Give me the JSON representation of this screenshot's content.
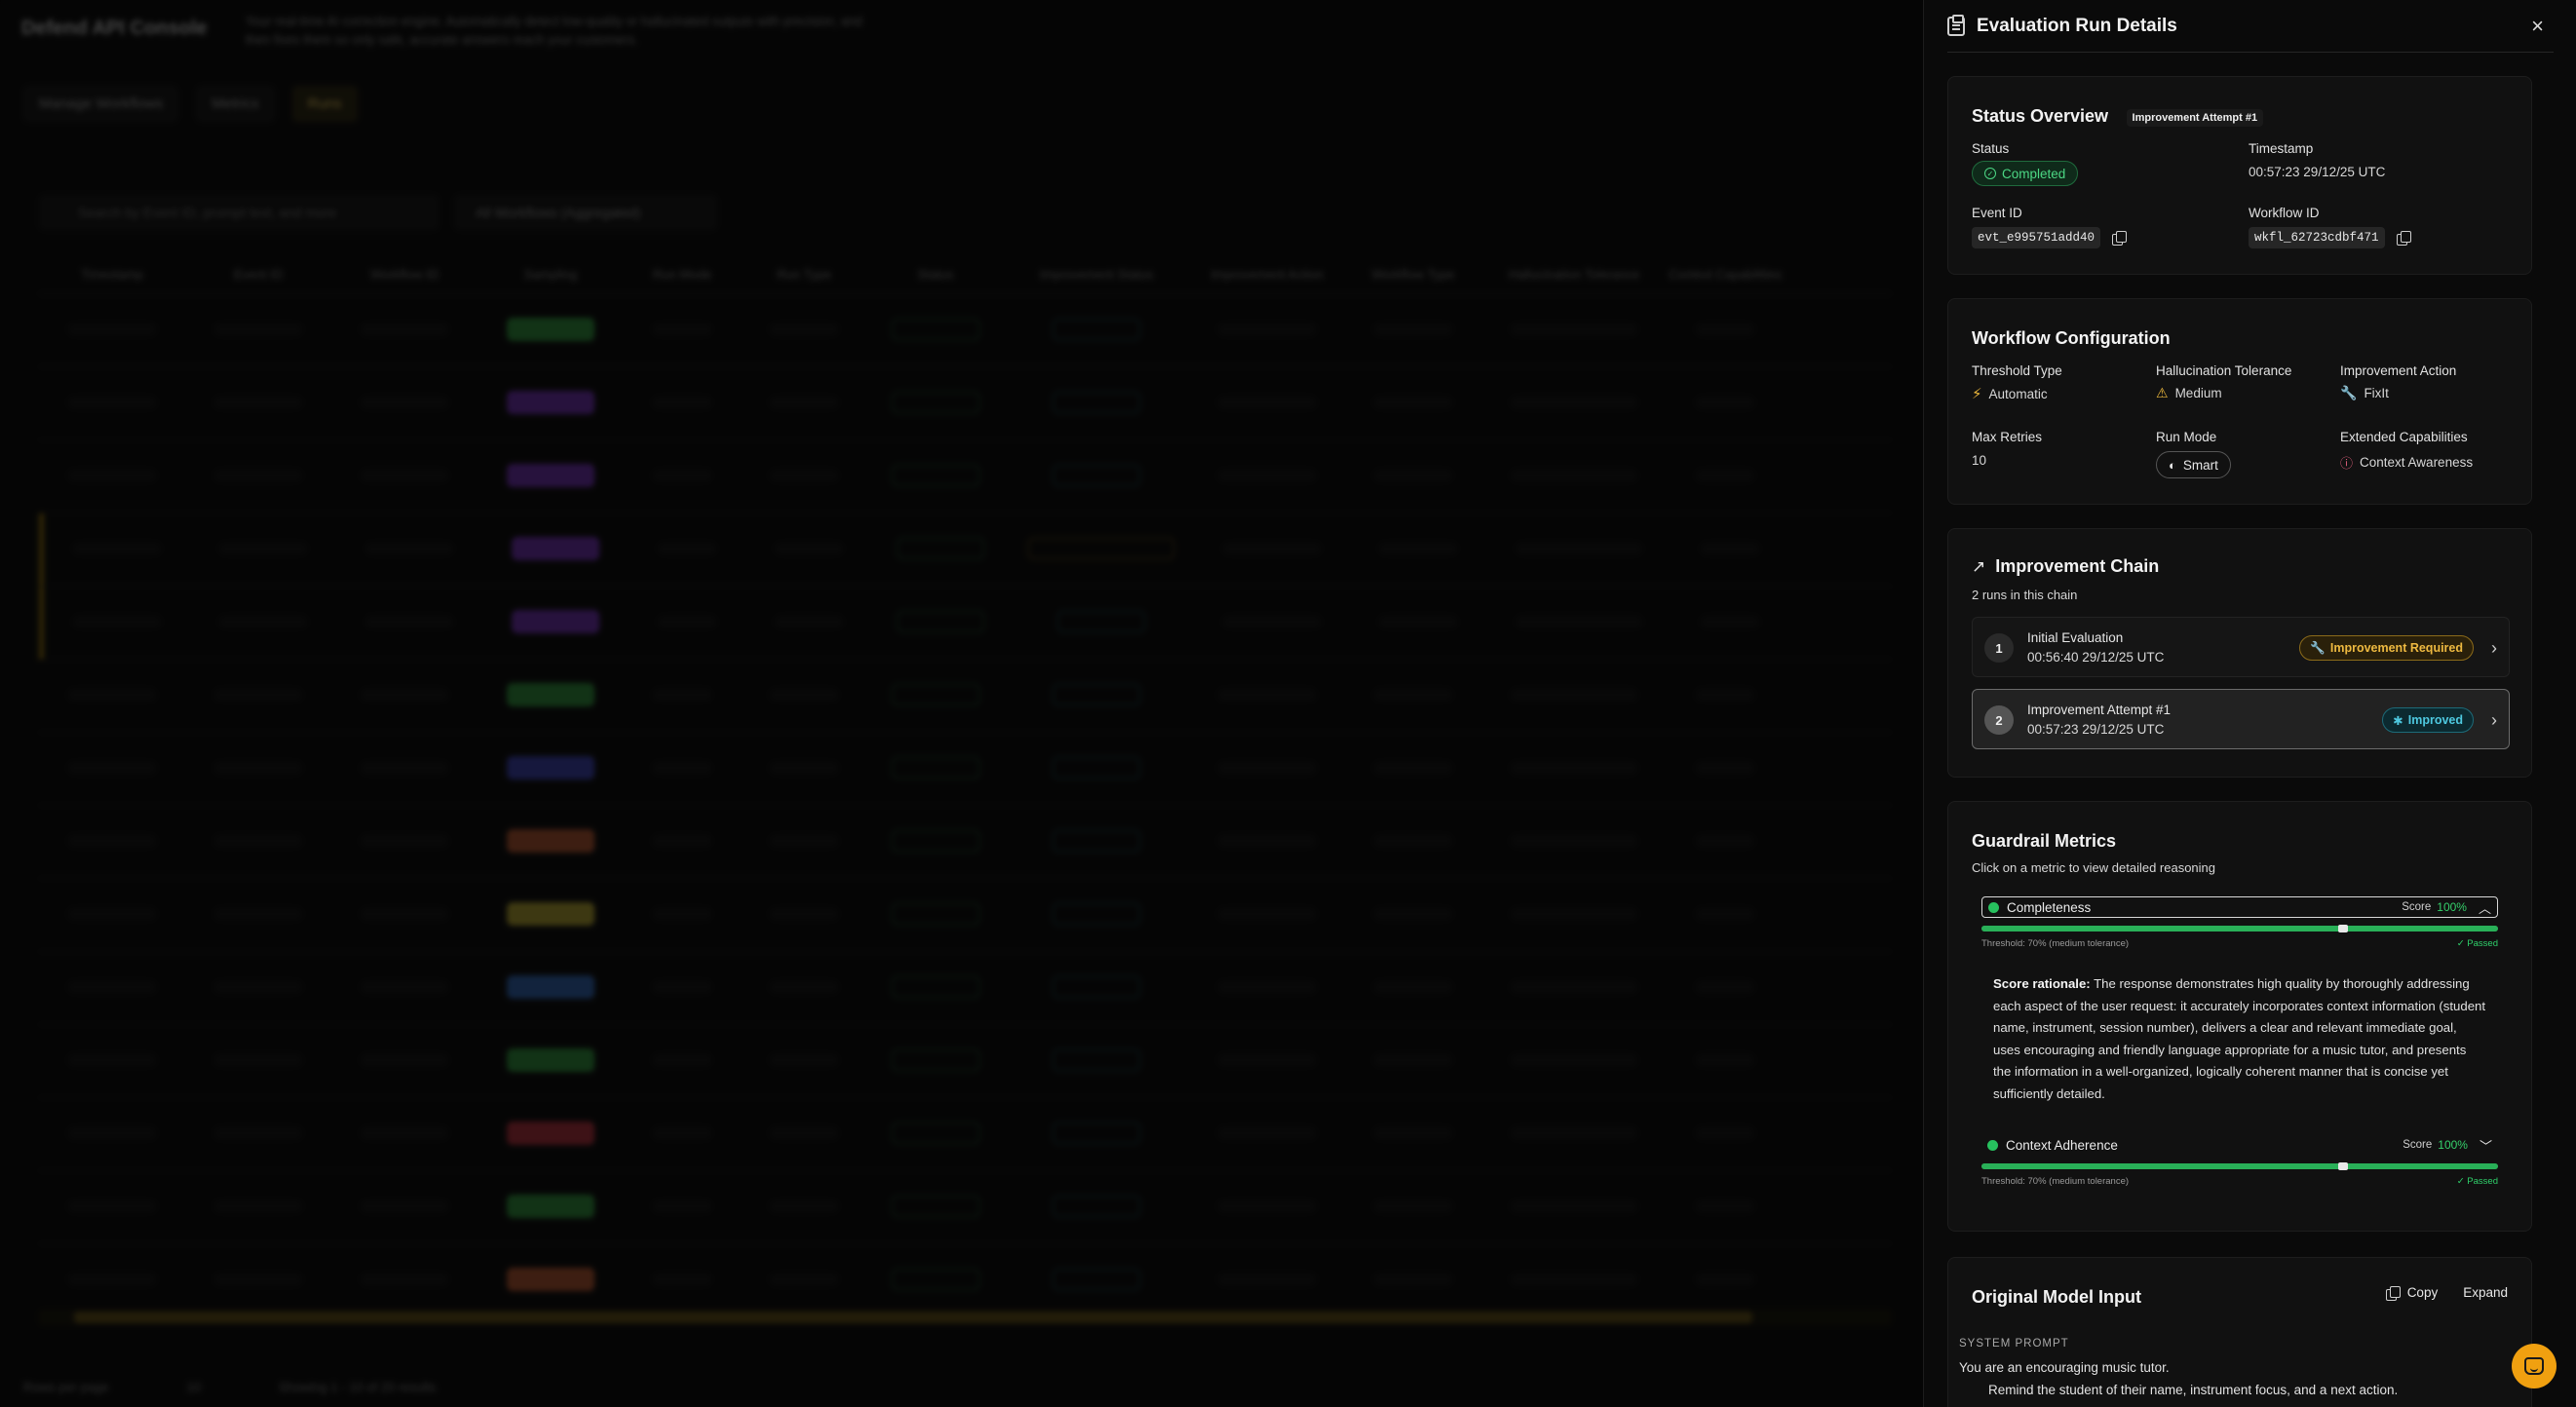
{
  "background": {
    "logo": "Defend API Console",
    "description": "Your real-time AI correction engine. Automatically detect low-quality or hallucinated outputs with precision, and then fixes them so only safe, accurate answers reach your customers.",
    "tabs": [
      "Manage Workflows",
      "Metrics",
      "Runs"
    ],
    "search_placeholder": "Search by Event ID, prompt text, and more",
    "workflow_filter": "All Workflows (Aggregated)",
    "columns": [
      "Timestamp",
      "Event ID",
      "Workflow ID",
      "Sampling",
      "Run Mode",
      "Run Type",
      "Status",
      "Improvement Status",
      "Improvement Action",
      "Workflow Type",
      "Hallucination Tolerance",
      "Context Capabilities"
    ],
    "rows_per_page_label": "Rows per page",
    "rows_per_page": "10",
    "showing": "Showing 1 - 10 of 20 results"
  },
  "panel": {
    "title": "Evaluation Run Details",
    "close_label": "×",
    "status_overview": {
      "title": "Status Overview",
      "tag": "Improvement Attempt #1",
      "status_label": "Status",
      "status_value": "Completed",
      "timestamp_label": "Timestamp",
      "timestamp_value": "00:57:23 29/12/25 UTC",
      "event_id_label": "Event ID",
      "event_id_value": "evt_e995751add40",
      "workflow_id_label": "Workflow ID",
      "workflow_id_value": "wkfl_62723cdbf471"
    },
    "workflow_config": {
      "title": "Workflow Configuration",
      "threshold_type_label": "Threshold Type",
      "threshold_type_value": "Automatic",
      "hallucination_label": "Hallucination Tolerance",
      "hallucination_value": "Medium",
      "improvement_action_label": "Improvement Action",
      "improvement_action_value": "FixIt",
      "max_retries_label": "Max Retries",
      "max_retries_value": "10",
      "run_mode_label": "Run Mode",
      "run_mode_value": "Smart",
      "extended_label": "Extended Capabilities",
      "extended_value": "Context Awareness"
    },
    "improvement_chain": {
      "title": "Improvement Chain",
      "subtitle": "2 runs in this chain",
      "items": [
        {
          "num": "1",
          "title": "Initial Evaluation",
          "time": "00:56:40 29/12/25 UTC",
          "badge": "Improvement Required"
        },
        {
          "num": "2",
          "title": "Improvement Attempt #1",
          "time": "00:57:23 29/12/25 UTC",
          "badge": "Improved"
        }
      ]
    },
    "guardrail": {
      "title": "Guardrail Metrics",
      "subtitle": "Click on a metric to view detailed reasoning",
      "score_label": "Score",
      "metrics": [
        {
          "name": "Completeness",
          "score": "100%",
          "score_fraction": 1.0,
          "threshold_fraction": 0.7,
          "threshold": "Threshold: 70% (medium tolerance)",
          "result": "✓ Passed"
        },
        {
          "name": "Context Adherence",
          "score": "100%",
          "score_fraction": 1.0,
          "threshold_fraction": 0.7,
          "threshold": "Threshold: 70% (medium tolerance)",
          "result": "✓ Passed"
        }
      ],
      "rationale_label": "Score rationale:",
      "rationale_text": " The response demonstrates high quality by thoroughly addressing each aspect of the user request: it accurately incorporates context information (student name, instrument, session number), delivers a clear and relevant immediate goal, uses encouraging and friendly language appropriate for a music tutor, and presents the information in a well-organized, logically coherent manner that is concise yet sufficiently detailed."
    },
    "original_input": {
      "title": "Original Model Input",
      "copy_label": "Copy",
      "expand_label": "Expand",
      "system_prompt_label": "SYSTEM PROMPT",
      "line1": "You are an encouraging music tutor.",
      "line2": "Remind the student of their name, instrument focus, and a next action."
    }
  },
  "colors": {
    "accent_green": "#4cd784",
    "accent_amber": "#eeb940",
    "accent_cyan": "#4ec9e0",
    "chat_button": "#f0a010"
  }
}
